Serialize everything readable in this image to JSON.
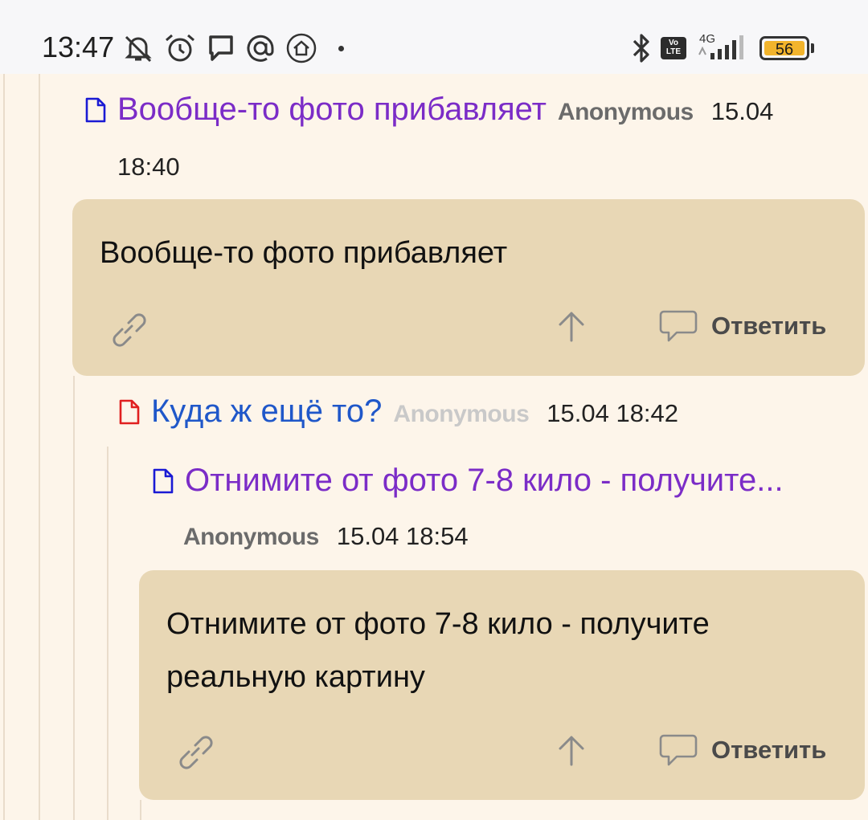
{
  "status_bar": {
    "time": "13:47",
    "network": "4G",
    "volte_label": "Vo LTE",
    "battery": "56",
    "icons": [
      "bell-off-icon",
      "alarm-icon",
      "message-icon",
      "at-sign-icon",
      "home-icon",
      "bluetooth-icon",
      "signal-icon"
    ]
  },
  "comments": [
    {
      "title": "Вообще-то фото прибавляет",
      "author": "Anonymous",
      "date_part1": "15.04",
      "date_part2": "18:40",
      "body": "Вообще-то фото прибавляет",
      "reply_label": "Ответить",
      "title_color": "#7b2cc7"
    },
    {
      "title": "Куда ж ещё то?",
      "author": "Anonymous",
      "date": "15.04 18:42",
      "title_color": "#1f57c9"
    },
    {
      "title": "Отнимите от фото 7-8 кило - получите...",
      "author": "Anonymous",
      "date": "15.04 18:54",
      "body_line1": "Отнимите от фото 7-8 кило - получите",
      "body_line2": "реальную картину",
      "reply_label": "Ответить",
      "title_color": "#7b2cc7"
    }
  ],
  "colors": {
    "background": "#fdf5ea",
    "card": "#e8d7b5",
    "doc_icon_blue": "#1a1ad4",
    "doc_icon_red": "#e01f1f"
  }
}
